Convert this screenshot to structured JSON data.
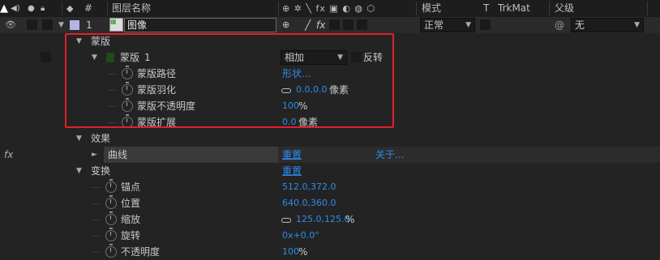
{
  "header": {
    "column_layer_name": "图层名称",
    "column_number": "#",
    "column_mode": "模式",
    "column_t": "T",
    "column_trkmat": "TrkMat",
    "column_parent": "父级"
  },
  "layer": {
    "number": "1",
    "name": "图像",
    "switch_fx": "fx",
    "mode": "正常",
    "parent": "无"
  },
  "mask_group": {
    "label": "蒙版",
    "mask1_label": "蒙版",
    "mask1_number": "1",
    "mask1_mode": "相加",
    "invert_label": "反转",
    "path_label": "蒙版路径",
    "path_value": "形状...",
    "feather_label": "蒙版羽化",
    "feather_value": "0.0,0.0",
    "feather_unit": "像素",
    "opacity_label": "蒙版不透明度",
    "opacity_value": "100",
    "opacity_unit": "%",
    "expansion_label": "蒙版扩展",
    "expansion_value": "0.0",
    "expansion_unit": "像素"
  },
  "effects": {
    "label": "效果",
    "fx_symbol": "fx",
    "curve_label": "曲线",
    "reset_label": "重置",
    "about_label": "关于..."
  },
  "transform": {
    "label": "变换",
    "reset_label": "重置",
    "anchor_label": "锚点",
    "anchor_value": "512.0,372.0",
    "position_label": "位置",
    "position_value": "640.0,360.0",
    "scale_label": "缩放",
    "scale_value": "125.0,125.0",
    "scale_unit": "%",
    "rotation_label": "旋转",
    "rotation_value": "0x+0.0°",
    "opacity_label": "不透明度",
    "opacity_value": "100",
    "opacity_unit": "%"
  },
  "colors": {
    "highlight": "#e0202a",
    "value_blue": "#2d8ceb",
    "label_color": "#b4b4e8"
  }
}
